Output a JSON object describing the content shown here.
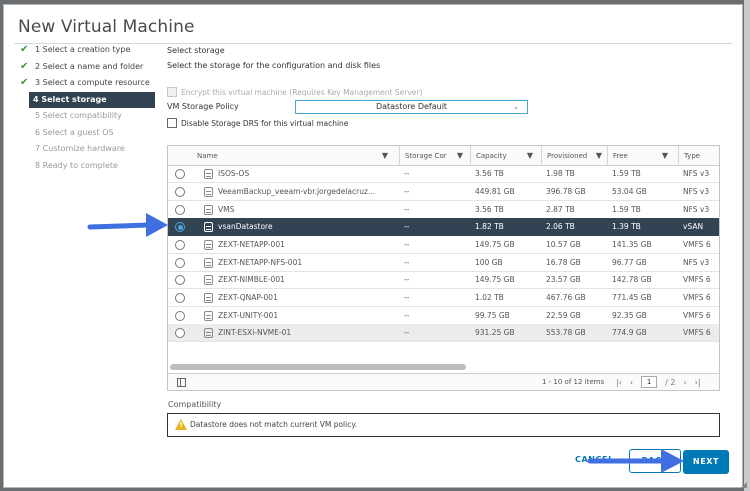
{
  "dialog": {
    "title": "New Virtual Machine"
  },
  "steps": [
    {
      "label": "1 Select a creation type",
      "state": "done"
    },
    {
      "label": "2 Select a name and folder",
      "state": "done"
    },
    {
      "label": "3 Select a compute resource",
      "state": "done"
    },
    {
      "label": "4 Select storage",
      "state": "active"
    },
    {
      "label": "5 Select compatibility",
      "state": "pending"
    },
    {
      "label": "6 Select a guest OS",
      "state": "pending"
    },
    {
      "label": "7 Customize hardware",
      "state": "pending"
    },
    {
      "label": "8 Ready to complete",
      "state": "pending"
    }
  ],
  "storage": {
    "title": "Select storage",
    "subtitle": "Select the storage for the configuration and disk files",
    "encrypt_label": "Encrypt this virtual machine (Requires Key Management Server)",
    "policy_label": "VM Storage Policy",
    "policy_value": "Datastore Default",
    "disable_drs_label": "Disable Storage DRS for this virtual machine"
  },
  "table": {
    "columns": [
      {
        "label": "Name"
      },
      {
        "label": "Storage Cor"
      },
      {
        "label": "Capacity"
      },
      {
        "label": "Provisioned"
      },
      {
        "label": "Free"
      },
      {
        "label": "Type"
      }
    ],
    "rows": [
      {
        "name": "ISOS-OS",
        "storage_compat": "--",
        "capacity": "3.56 TB",
        "provisioned": "1.98 TB",
        "free": "1.59 TB",
        "type": "NFS v3"
      },
      {
        "name": "VeeamBackup_veeam-vbr.jorgedelacruz...",
        "storage_compat": "--",
        "capacity": "449.81 GB",
        "provisioned": "396.78 GB",
        "free": "53.04 GB",
        "type": "NFS v3"
      },
      {
        "name": "VMS",
        "storage_compat": "--",
        "capacity": "3.56 TB",
        "provisioned": "2.87 TB",
        "free": "1.59 TB",
        "type": "NFS v3"
      },
      {
        "name": "vsanDatastore",
        "storage_compat": "--",
        "capacity": "1.82 TB",
        "provisioned": "2.06 TB",
        "free": "1.39 TB",
        "type": "vSAN",
        "selected": true
      },
      {
        "name": "ZEXT-NETAPP-001",
        "storage_compat": "--",
        "capacity": "149.75 GB",
        "provisioned": "10.57 GB",
        "free": "141.35 GB",
        "type": "VMFS 6"
      },
      {
        "name": "ZEXT-NETAPP-NFS-001",
        "storage_compat": "--",
        "capacity": "100 GB",
        "provisioned": "16.78 GB",
        "free": "96.77 GB",
        "type": "NFS v3"
      },
      {
        "name": "ZEXT-NIMBLE-001",
        "storage_compat": "--",
        "capacity": "149.75 GB",
        "provisioned": "23.57 GB",
        "free": "142.78 GB",
        "type": "VMFS 6"
      },
      {
        "name": "ZEXT-QNAP-001",
        "storage_compat": "--",
        "capacity": "1.02 TB",
        "provisioned": "467.76 GB",
        "free": "771.45 GB",
        "type": "VMFS 6"
      },
      {
        "name": "ZEXT-UNITY-001",
        "storage_compat": "--",
        "capacity": "99.75 GB",
        "provisioned": "22.59 GB",
        "free": "92.35 GB",
        "type": "VMFS 6"
      },
      {
        "name": "ZINT-ESXi-NVME-01",
        "storage_compat": "--",
        "capacity": "931.25 GB",
        "provisioned": "553.78 GB",
        "free": "774.9 GB",
        "type": "VMFS 6",
        "hover": true
      }
    ],
    "footer": {
      "items_text": "1 - 10 of 12 items",
      "page": "1",
      "page_total": "/ 2"
    }
  },
  "compatibility": {
    "label": "Compatibility",
    "message": "Datastore does not match current VM policy."
  },
  "buttons": {
    "cancel": "CANCEL",
    "back": "BACK",
    "next": "NEXT"
  },
  "colors": {
    "selected_row": "#324354",
    "primary": "#0079b8",
    "annotation_arrow": "#3f6fe0",
    "warning": "#e8b227"
  }
}
